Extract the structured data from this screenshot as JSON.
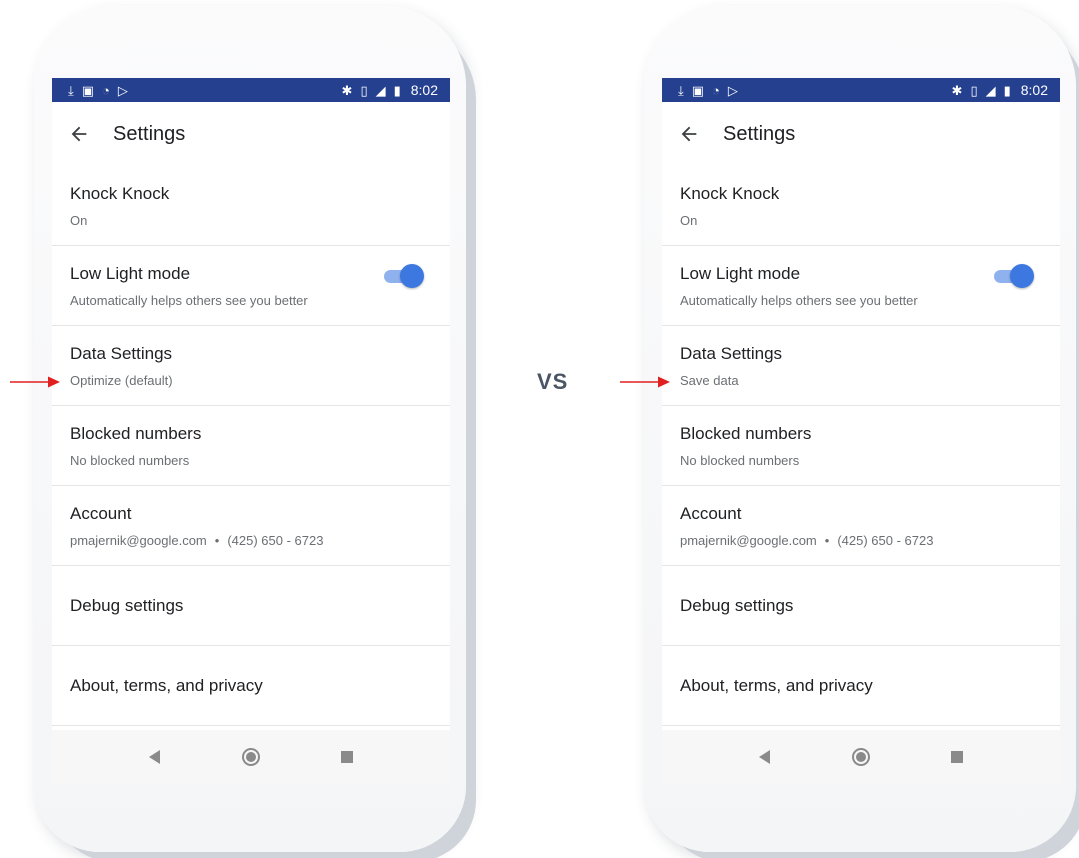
{
  "comparison_label": "VS",
  "phones": [
    {
      "status_time": "8:02",
      "appbar_title": "Settings",
      "items": [
        {
          "title": "Knock Knock",
          "subtitle": "On"
        },
        {
          "title": "Low Light mode",
          "subtitle": "Automatically helps others see you better",
          "toggle": true
        },
        {
          "title": "Data Settings",
          "subtitle": "Optimize (default)"
        },
        {
          "title": "Blocked numbers",
          "subtitle": "No blocked numbers"
        },
        {
          "title": "Account",
          "subtitle_email": "pmajernik@google.com",
          "subtitle_separator": "•",
          "subtitle_phone": "(425) 650 - 6723"
        },
        {
          "title": "Debug settings"
        },
        {
          "title": "About, terms, and privacy"
        }
      ]
    },
    {
      "status_time": "8:02",
      "appbar_title": "Settings",
      "items": [
        {
          "title": "Knock Knock",
          "subtitle": "On"
        },
        {
          "title": "Low Light mode",
          "subtitle": "Automatically helps others see you better",
          "toggle": true
        },
        {
          "title": "Data Settings",
          "subtitle": "Save data"
        },
        {
          "title": "Blocked numbers",
          "subtitle": "No blocked numbers"
        },
        {
          "title": "Account",
          "subtitle_email": "pmajernik@google.com",
          "subtitle_separator": "•",
          "subtitle_phone": "(425) 650 - 6723"
        },
        {
          "title": "Debug settings"
        },
        {
          "title": "About, terms, and privacy"
        }
      ]
    }
  ],
  "colors": {
    "status_bar": "#24408f",
    "toggle_thumb": "#3c78e0",
    "toggle_track": "#8fb1ee",
    "arrow": "#e02020"
  },
  "icons": {
    "status_left": [
      "download-icon",
      "image-icon",
      "wifi-icon",
      "cast-icon"
    ],
    "status_right": [
      "bluetooth-icon",
      "vibrate-icon",
      "lte-signal-icon",
      "battery-icon"
    ],
    "appbar": "back-arrow-icon",
    "nav": [
      "nav-back-icon",
      "nav-home-icon",
      "nav-recents-icon"
    ],
    "pointer": "red-arrow-icon"
  }
}
